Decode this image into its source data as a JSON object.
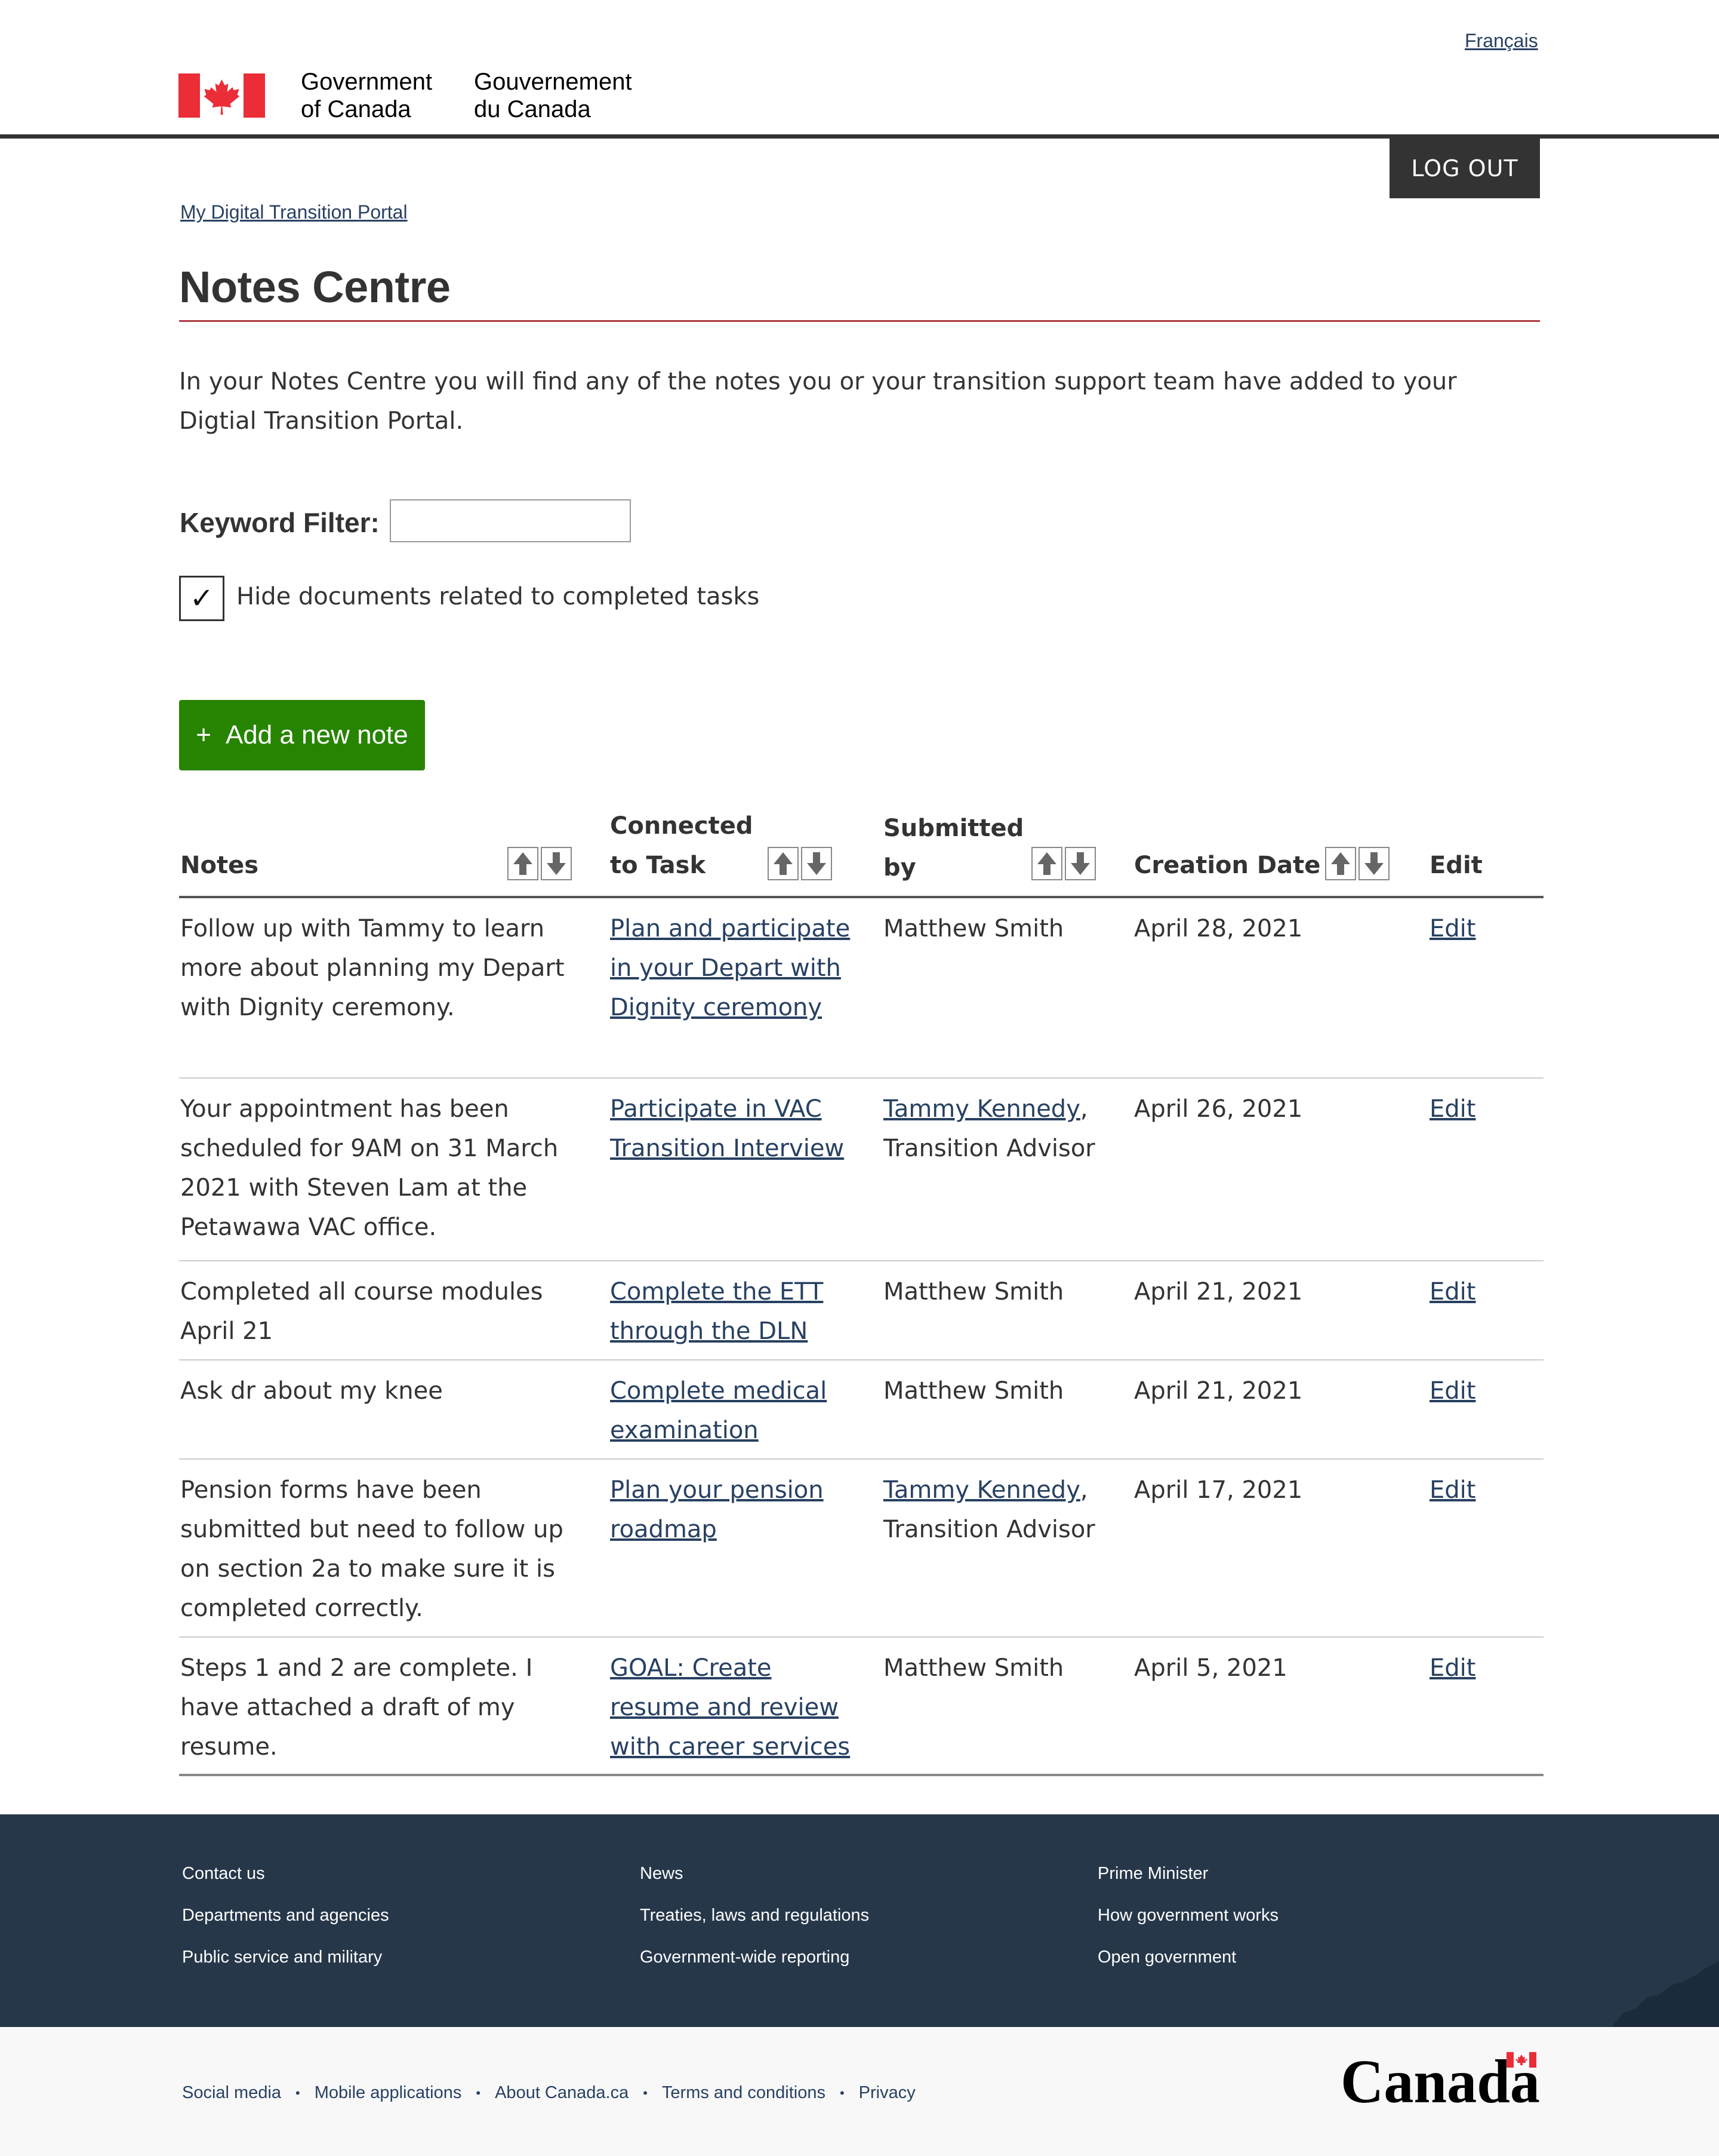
{
  "header": {
    "lang_toggle": "Français",
    "signature_en_line1": "Government",
    "signature_en_line2": "of Canada",
    "signature_fr_line1": "Gouvernement",
    "signature_fr_line2": "du Canada",
    "logout_label": "LOG OUT"
  },
  "breadcrumb": {
    "link": "My Digital Transition Portal"
  },
  "page": {
    "title": "Notes Centre",
    "intro": "In your Notes Centre you will find any of the notes you or your transition support team have added to your Digtial Transition Portal."
  },
  "filter": {
    "label": "Keyword Filter:",
    "value": "",
    "checkbox_checked": true,
    "checkbox_mark": "✓",
    "checkbox_label": "Hide documents related to completed tasks"
  },
  "add_note": {
    "plus": "+",
    "label": "Add a new note"
  },
  "table": {
    "headers": {
      "notes": "Notes",
      "task_line1": "Connected",
      "task_line2": "to Task",
      "by_line1": "Submitted",
      "by_line2": "by",
      "date": "Creation Date",
      "edit": "Edit"
    },
    "rows": [
      {
        "note": "Follow up with Tammy to learn more about planning my Depart with Dignity ceremony.",
        "task": "Plan and participate in your Depart with Dignity ceremony",
        "by_link": "",
        "by_text": "Matthew Smith",
        "date": "April 28, 2021",
        "edit": "Edit"
      },
      {
        "note": "Your appointment has been scheduled for 9AM on 31 March 2021 with Steven Lam at the Petawawa VAC office.",
        "task": "Participate in VAC Transition Interview",
        "by_link": "Tammy Kennedy",
        "by_text": ", Transition Advisor",
        "date": "April 26, 2021",
        "edit": "Edit"
      },
      {
        "note": "Completed all course modules April 21",
        "task": "Complete the ETT through the DLN",
        "by_link": "",
        "by_text": "Matthew Smith",
        "date": "April 21, 2021",
        "edit": "Edit"
      },
      {
        "note": "Ask dr about my knee",
        "task": "Complete medical examination",
        "by_link": "",
        "by_text": "Matthew Smith",
        "date": "April 21, 2021",
        "edit": "Edit"
      },
      {
        "note": "Pension forms have been submitted but need to follow up on section 2a to make sure it is completed correctly.",
        "task": "Plan your pension roadmap",
        "by_link": "Tammy Kennedy",
        "by_text": ", Transition Advisor",
        "date": "April 17, 2021",
        "edit": "Edit"
      },
      {
        "note": "Steps 1 and 2 are complete. I have attached a draft of my resume.",
        "task": "GOAL: Create resume and review with career  services",
        "by_link": "",
        "by_text": "Matthew Smith",
        "date": "April 5, 2021",
        "edit": "Edit"
      }
    ]
  },
  "footer": {
    "col1": [
      "Contact us",
      "Departments and agencies",
      "Public service and military"
    ],
    "col2": [
      "News",
      "Treaties, laws and regulations",
      "Government-wide reporting"
    ],
    "col3": [
      "Prime Minister",
      "How government works",
      "Open government"
    ],
    "sub_links": [
      "Social media",
      "Mobile applications",
      "About Canada.ca",
      "Terms and conditions",
      "Privacy"
    ],
    "wordmark": "Canada"
  },
  "colors": {
    "brand_red": "#eb2d37",
    "title_rule": "#af3c43",
    "link": "#284162",
    "button_green": "#278400",
    "footer_bg": "#26374a"
  }
}
